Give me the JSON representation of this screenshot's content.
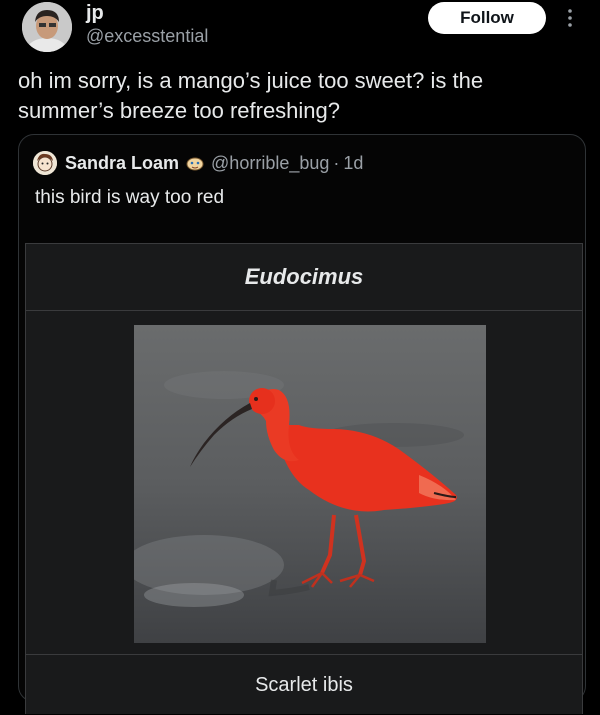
{
  "post": {
    "display_name": "jp",
    "handle": "@excesstential",
    "follow_label": "Follow",
    "text": "oh im sorry, is a mango’s juice too sweet? is the summer’s breeze too refreshing?"
  },
  "quoted": {
    "display_name": "Sandra Loam",
    "handle": "@horrible_bug",
    "separator": "·",
    "time": "1d",
    "text": "this bird is way too red",
    "card": {
      "genus": "Eudocimus",
      "caption": "Scarlet ibis"
    }
  },
  "icons": {
    "more": "more-vertical-icon",
    "badge": "emoji-badge-icon"
  },
  "colors": {
    "background": "#000000",
    "follow_button": "#ffffff",
    "secondary_text": "#9aa0a6",
    "bird": "#e8311e"
  }
}
